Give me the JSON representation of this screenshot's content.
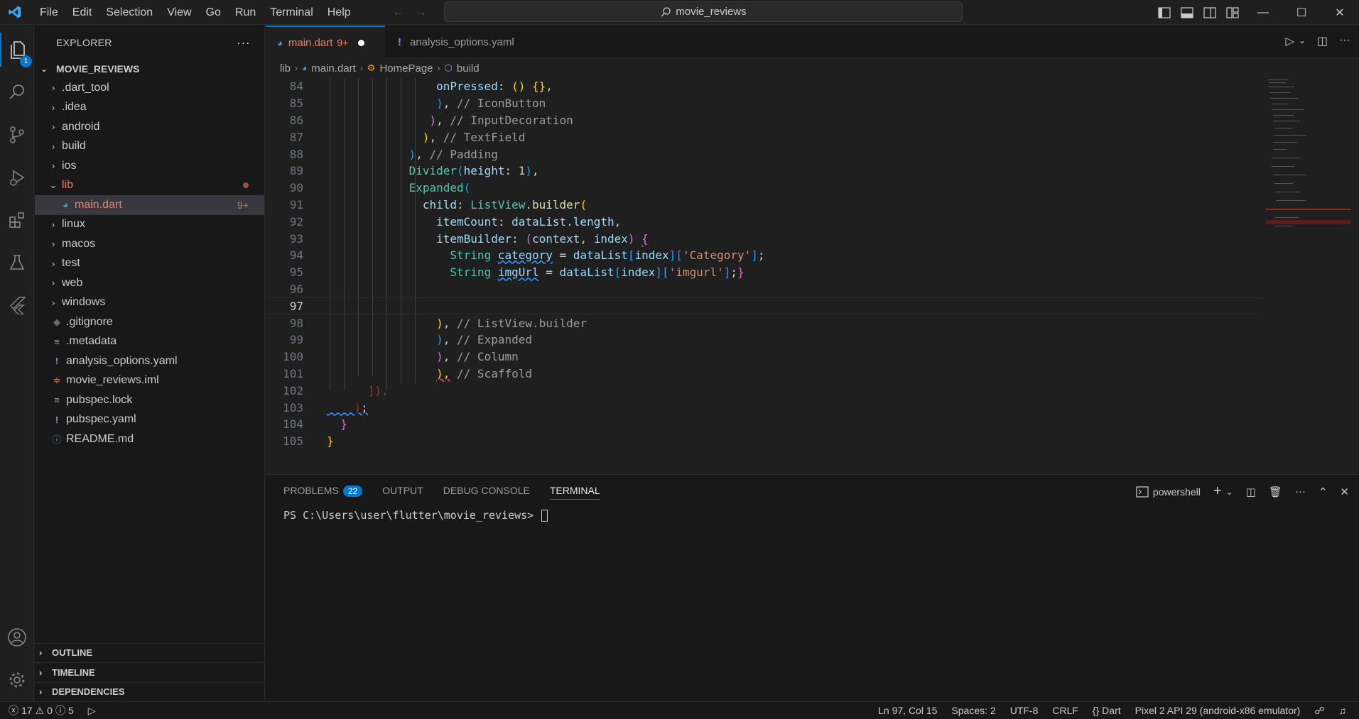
{
  "menu": [
    "File",
    "Edit",
    "Selection",
    "View",
    "Go",
    "Run",
    "Terminal",
    "Help"
  ],
  "search": {
    "text": "movie_reviews"
  },
  "activity": {
    "explorer_badge": "1"
  },
  "sidebar": {
    "title": "EXPLORER",
    "project": "MOVIE_REVIEWS",
    "items": [
      {
        "label": ".dart_tool",
        "type": "folder"
      },
      {
        "label": ".idea",
        "type": "folder"
      },
      {
        "label": "android",
        "type": "folder"
      },
      {
        "label": "build",
        "type": "folder"
      },
      {
        "label": "ios",
        "type": "folder"
      },
      {
        "label": "lib",
        "type": "folder-open"
      },
      {
        "label": "main.dart",
        "type": "file",
        "badge": "9+"
      },
      {
        "label": "linux",
        "type": "folder"
      },
      {
        "label": "macos",
        "type": "folder"
      },
      {
        "label": "test",
        "type": "folder"
      },
      {
        "label": "web",
        "type": "folder"
      },
      {
        "label": "windows",
        "type": "folder"
      },
      {
        "label": ".gitignore",
        "type": "file"
      },
      {
        "label": ".metadata",
        "type": "file"
      },
      {
        "label": "analysis_options.yaml",
        "type": "file"
      },
      {
        "label": "movie_reviews.iml",
        "type": "file"
      },
      {
        "label": "pubspec.lock",
        "type": "file"
      },
      {
        "label": "pubspec.yaml",
        "type": "file"
      },
      {
        "label": "README.md",
        "type": "file"
      }
    ],
    "sections": [
      "OUTLINE",
      "TIMELINE",
      "DEPENDENCIES"
    ]
  },
  "tabs": [
    {
      "label": "main.dart",
      "badge": "9+"
    },
    {
      "label": "analysis_options.yaml"
    }
  ],
  "breadcrumb": [
    "lib",
    "main.dart",
    "HomePage",
    "build"
  ],
  "code": {
    "line_numbers": [
      "84",
      "85",
      "86",
      "87",
      "88",
      "89",
      "90",
      "91",
      "92",
      "93",
      "94",
      "95",
      "96",
      "97",
      "98",
      "99",
      "100",
      "101",
      "102",
      "103",
      "104",
      "105"
    ],
    "comments": {
      "l85": "// IconButton",
      "l86": "// InputDecoration",
      "l87": "// TextField",
      "l88": "// Padding",
      "l98": "// ListView.builder",
      "l99": "// Expanded",
      "l100": "// Column",
      "l101": "// Scaffold"
    },
    "strings": {
      "category": "'Category'",
      "imgurl": "'imgurl'"
    }
  },
  "panel": {
    "tabs": [
      "PROBLEMS",
      "OUTPUT",
      "DEBUG CONSOLE",
      "TERMINAL"
    ],
    "problems_count": "22",
    "shell": "powershell",
    "prompt": "PS C:\\Users\\user\\flutter\\movie_reviews> "
  },
  "status": {
    "errors": "17",
    "warnings": "0",
    "info": "5",
    "position": "Ln 97, Col 15",
    "spaces": "Spaces: 2",
    "encoding": "UTF-8",
    "eol": "CRLF",
    "language": "Dart",
    "device": "Pixel 2 API 29 (android-x86 emulator)"
  }
}
